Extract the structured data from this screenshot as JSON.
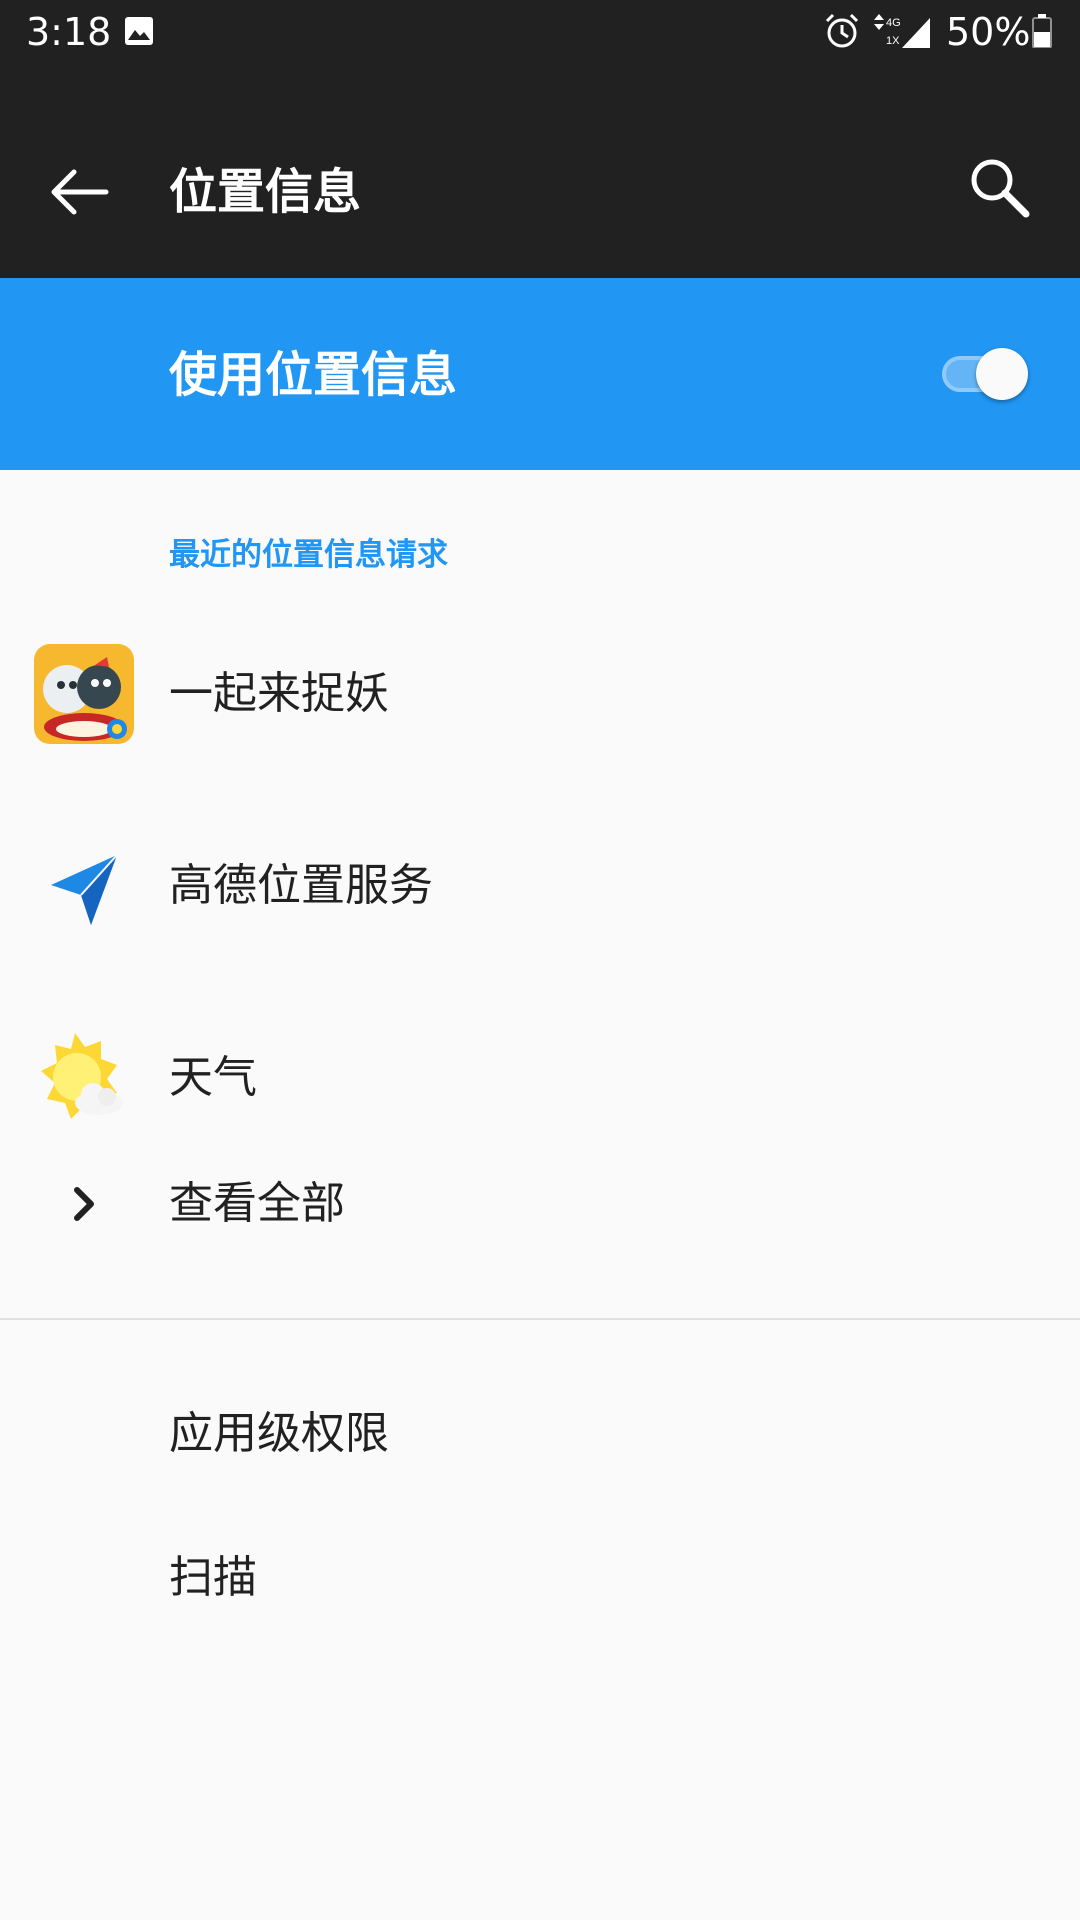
{
  "status_bar": {
    "time": "3:18",
    "network_type": "4G",
    "sim_label": "1X",
    "battery": "50%"
  },
  "app_bar": {
    "title": "位置信息"
  },
  "master_switch": {
    "label": "使用位置信息",
    "on": true
  },
  "recent_requests": {
    "header": "最近的位置信息请求",
    "items": [
      {
        "label": "一起来捉妖",
        "icon": "game-app-icon"
      },
      {
        "label": "高德位置服务",
        "icon": "paper-plane-icon"
      },
      {
        "label": "天气",
        "icon": "weather-sun-cloud-icon"
      }
    ],
    "view_all": "查看全部"
  },
  "settings": {
    "items": [
      {
        "label": "应用级权限"
      },
      {
        "label": "扫描"
      }
    ]
  },
  "colors": {
    "accent": "#2196f3",
    "app_bar": "#212121",
    "background": "#fafafa",
    "text": "#212121"
  }
}
